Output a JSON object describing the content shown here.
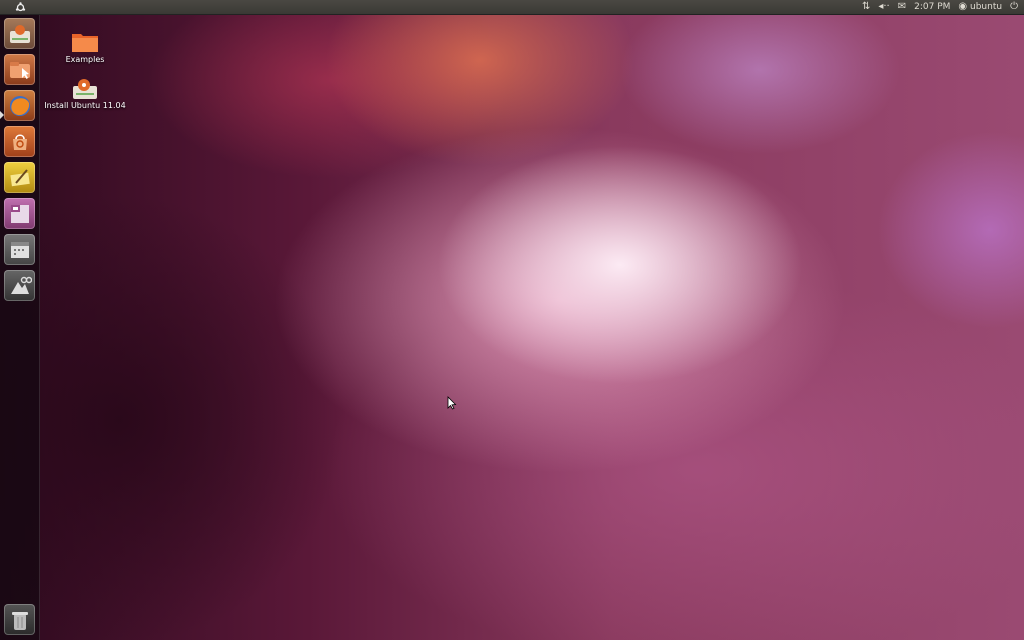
{
  "top_panel": {
    "clock": "2:07 PM",
    "user": "ubuntu",
    "icons": [
      "ubuntu-logo-icon",
      "network-icon",
      "volume-icon",
      "mail-icon",
      "user-icon",
      "power-icon"
    ]
  },
  "launcher": {
    "items": [
      {
        "name": "installer",
        "icon": "installer-icon",
        "color": "#c0855a"
      },
      {
        "name": "files",
        "icon": "home-folder-icon",
        "color": "#c06a3a"
      },
      {
        "name": "firefox",
        "icon": "firefox-icon",
        "color": "#d66a1e"
      },
      {
        "name": "software-center",
        "icon": "software-center-icon",
        "color": "#d8672c"
      },
      {
        "name": "text-editor",
        "icon": "text-editor-icon",
        "color": "#d8b32a"
      },
      {
        "name": "workspaces",
        "icon": "workspaces-icon",
        "color": "#b65aa0"
      },
      {
        "name": "applications",
        "icon": "applications-icon",
        "color": "#666666"
      },
      {
        "name": "files-folders",
        "icon": "files-folders-icon",
        "color": "#555555"
      }
    ],
    "trash_icon": "trash-icon"
  },
  "desktop": {
    "icons": [
      {
        "label": "Examples",
        "icon": "folder-icon"
      },
      {
        "label": "Install Ubuntu 11.04",
        "icon": "installer-icon"
      }
    ]
  },
  "colors": {
    "panel": "#3c3b37",
    "accent": "#dd4814"
  }
}
